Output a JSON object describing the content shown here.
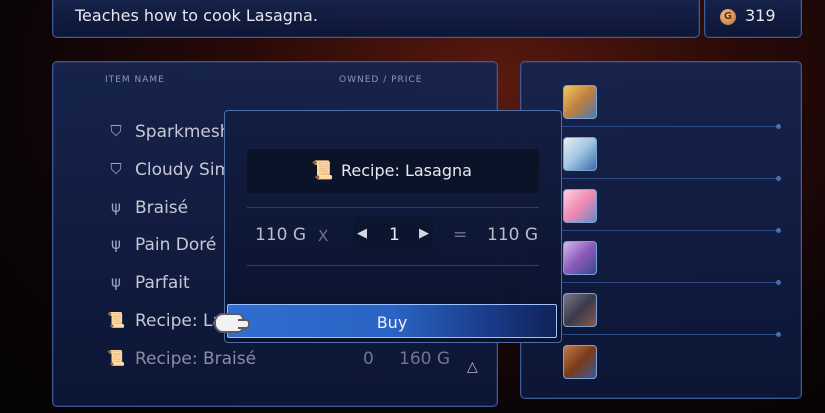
{
  "description": {
    "text": "Teaches how to cook Lasagna."
  },
  "currency": {
    "symbol": "G",
    "amount": "319"
  },
  "list": {
    "header_name": "ITEM NAME",
    "header_price": "OWNED / PRICE",
    "items": [
      {
        "label": "Sparkmesh",
        "icon": "shield-icon",
        "owned": "",
        "price": ""
      },
      {
        "label": "Cloudy Sim",
        "icon": "shield-icon",
        "owned": "",
        "price": ""
      },
      {
        "label": "Braisé",
        "icon": "fork-icon",
        "owned": "",
        "price": ""
      },
      {
        "label": "Pain Doré",
        "icon": "utensils-icon",
        "owned": "",
        "price": ""
      },
      {
        "label": "Parfait",
        "icon": "fork-icon",
        "owned": "",
        "price": ""
      },
      {
        "label": "Recipe: La",
        "icon": "scroll-icon",
        "owned": "",
        "price": ""
      },
      {
        "label": "Recipe: Braisé",
        "icon": "scroll-icon",
        "owned": "0",
        "price": "160 G"
      }
    ]
  },
  "dialog": {
    "item_title": "Recipe: Lasagna",
    "unit_price": "110 G",
    "times": "X",
    "quantity": "1",
    "equals": "=",
    "total": "110 G",
    "buy_label": "Buy"
  },
  "party": {
    "portraits": [
      "blonde-hero",
      "white-haired-hero",
      "pink-creature",
      "purple-haired-hero",
      "dark-haired-hero",
      "brown-haired-hero"
    ]
  }
}
